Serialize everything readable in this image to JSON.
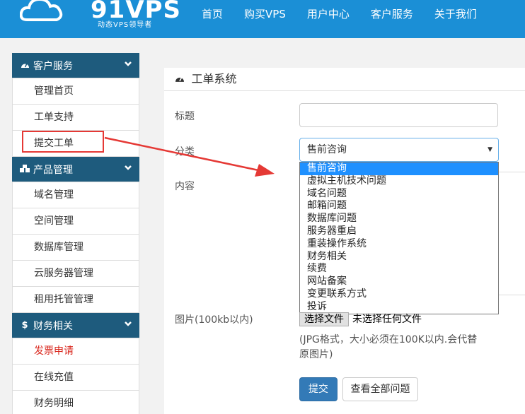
{
  "header": {
    "logo_text": "91VPS",
    "logo_slogan": "动态VPS领导者",
    "nav": [
      "首页",
      "购买VPS",
      "用户中心",
      "客户服务",
      "关于我们"
    ]
  },
  "sidebar": {
    "groups": [
      {
        "title": "客户服务",
        "icon": "dashboard-icon",
        "items": [
          "管理首页",
          "工单支持",
          "提交工单"
        ]
      },
      {
        "title": "产品管理",
        "icon": "cubes-icon",
        "items": [
          "域名管理",
          "空间管理",
          "数据库管理",
          "云服务器管理",
          "租用托管管理"
        ]
      },
      {
        "title": "财务相关",
        "icon": "dollar-icon",
        "items": [
          "发票申请",
          "在线充值",
          "财务明细"
        ]
      }
    ]
  },
  "form": {
    "title": "工单系统",
    "title_label": "标题",
    "category_label": "分类",
    "content_label": "内容",
    "image_label": "图片(100kb以内)",
    "category_value": "售前咨询",
    "category_options": [
      "售前咨询",
      "虚拟主机技术问题",
      "域名问题",
      "邮箱问题",
      "数据库问题",
      "服务器重启",
      "重装操作系统",
      "财务相关",
      "续费",
      "网站备案",
      "变更联系方式",
      "投诉"
    ],
    "file_button": "选择文件",
    "file_status": "未选择任何文件",
    "hint": "(JPG格式，大小必须在100K以内.会代替原图片)",
    "submit": "提交",
    "view_all": "查看全部问题"
  },
  "colors": {
    "topbar": "#1b8fd6",
    "sidebar_header": "#1e5b7d",
    "active_item": "#d9261c",
    "annotation": "#e53935",
    "dropdown_selected": "#1e90ff"
  }
}
